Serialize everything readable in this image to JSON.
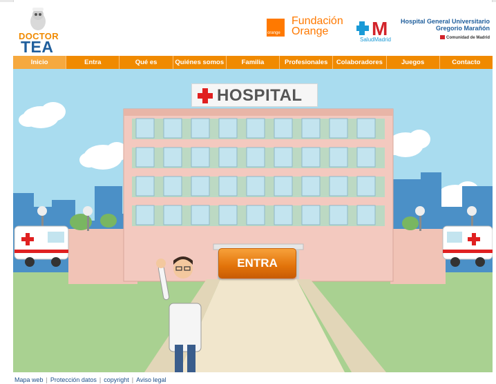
{
  "header": {
    "logo": {
      "line1": "DOCTOR",
      "line2": "TEA"
    },
    "fundacion_orange": {
      "badge": "orange",
      "line1": "Fundación",
      "line2": "Orange"
    },
    "salud_madrid": {
      "mark": "M",
      "caption": "SaludMadrid"
    },
    "hospital": {
      "line1": "Hospital General Universitario",
      "line2": "Gregorio Marañón",
      "line3": "Comunidad de Madrid"
    }
  },
  "nav": {
    "items": [
      "Inicio",
      "Entra",
      "Qué es",
      "Quiénes somos",
      "Familia",
      "Profesionales",
      "Colaboradores",
      "Juegos",
      "Contacto"
    ],
    "active_index": 0
  },
  "scene": {
    "hospital_sign": "HOSPITAL",
    "entra_button": "ENTRA"
  },
  "footer": {
    "links": [
      "Mapa web",
      "Protección datos",
      "copyright",
      "Aviso legal"
    ]
  },
  "colors": {
    "nav_bg": "#f08a00",
    "sky": "#a9dcef",
    "grass": "#a9d191",
    "building": "#f3c9bf",
    "window": "#c3e4ef",
    "orange_brand": "#ff7900",
    "blue_brand": "#1f5e9c"
  },
  "icons": [
    "doctor-tea-logo-icon",
    "fundacion-orange-logo-icon",
    "salud-madrid-logo-icon",
    "comunidad-madrid-flag-icon",
    "red-cross-icon",
    "ambulance-icon",
    "doctor-character-icon"
  ]
}
